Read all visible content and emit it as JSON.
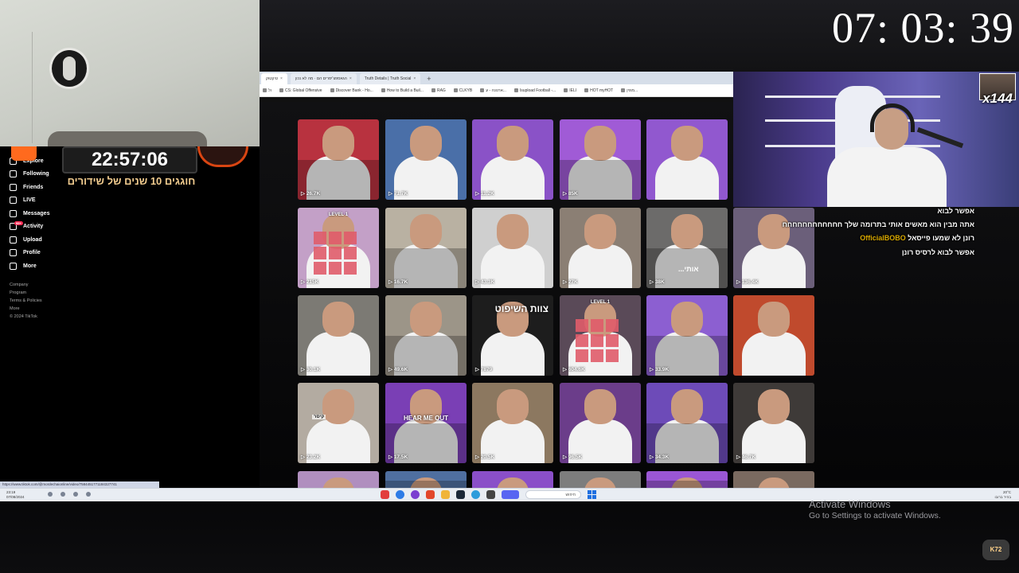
{
  "clock": "07: 03: 39",
  "overlay": {
    "timer": "22:57:06",
    "timer_sub": "חוגגים 10 שנים של שידורים",
    "multiplier": "x144"
  },
  "browser": {
    "tabs": [
      {
        "label": "טיקטוק",
        "active": true
      },
      {
        "label": "הגאספצ'יסרים הם · מה לא נכון",
        "active": false
      },
      {
        "label": "Truth Details | Truth Social",
        "active": false
      }
    ],
    "new_tab": "+",
    "bookmarks": [
      "ול",
      "CS: Global Offensive",
      "Discover Bank - Ho...",
      "How to Build a Buil...",
      "RAG",
      "CLKYB",
      "ארנונה - ע...",
      "Isupload Football -...",
      "IELI",
      "HOT myHOT",
      "מגזין..."
    ]
  },
  "sidebar": {
    "items": [
      {
        "label": "Explore",
        "icon": "compass-icon"
      },
      {
        "label": "Following",
        "icon": "following-icon"
      },
      {
        "label": "Friends",
        "icon": "friends-icon"
      },
      {
        "label": "LIVE",
        "icon": "live-icon"
      },
      {
        "label": "Messages",
        "icon": "messages-icon",
        "badge": ""
      },
      {
        "label": "Activity",
        "icon": "activity-icon",
        "badge": "99+"
      },
      {
        "label": "Upload",
        "icon": "upload-icon"
      },
      {
        "label": "Profile",
        "icon": "profile-icon"
      },
      {
        "label": "More",
        "icon": "more-icon"
      }
    ],
    "footer": [
      "Company",
      "Program",
      "Terms & Policies",
      "More",
      "© 2024 TikTok"
    ]
  },
  "videos": [
    {
      "views": "26.7K",
      "caption": "",
      "bg": "#b8323f"
    },
    {
      "views": "71.7K",
      "caption": "",
      "bg": "#4a6fa8"
    },
    {
      "views": "11.2K",
      "caption": "",
      "bg": "#8a52c7"
    },
    {
      "views": "85K",
      "caption": "",
      "bg": "#a05bd6"
    },
    {
      "views": "",
      "caption": "",
      "bg": "#9158cf"
    },
    {
      "views": "215K",
      "caption": "LEVEL 1",
      "bg": "#c3a0c7",
      "tiles": true
    },
    {
      "views": "16.7K",
      "caption": "",
      "bg": "#b9b1a2"
    },
    {
      "views": "43.3K",
      "caption": "",
      "bg": "#cfcfcf"
    },
    {
      "views": "27K",
      "caption": "",
      "bg": "#8b7f74"
    },
    {
      "views": "38K",
      "caption": "",
      "bg": "#6c6b6a",
      "otti": "אותי..."
    },
    {
      "views": "136.4K",
      "caption": "",
      "bg": "#6b5f7a"
    },
    {
      "views": "30.1K",
      "caption": "",
      "bg": "#7c7a74"
    },
    {
      "views": "49.6K",
      "caption": "",
      "bg": "#9c9588"
    },
    {
      "views": "7879",
      "caption": "",
      "bg": "#1d1d1d",
      "big": "צוות השיפוט"
    },
    {
      "views": "604.6K",
      "caption": "LEVEL 1",
      "bg": "#5a4a58",
      "tiles": true
    },
    {
      "views": "33.9K",
      "caption": "",
      "bg": "#8c5fd1"
    },
    {
      "views": "",
      "caption": "",
      "bg": "#c04a2d"
    },
    {
      "views": "23.2K",
      "caption": "",
      "bg": "#b3aba1",
      "kisur": "קיסר"
    },
    {
      "views": "17.5K",
      "caption": "",
      "bg": "#7a3fb5",
      "hme": "HEAR ME OUT"
    },
    {
      "views": "20.5K",
      "caption": "",
      "bg": "#8c7860"
    },
    {
      "views": "96.5K",
      "caption": "",
      "bg": "#6b3d8a"
    },
    {
      "views": "34.3K",
      "caption": "",
      "bg": "#6d4bb8"
    },
    {
      "views": "46.7K",
      "caption": "",
      "bg": "#3e3a38"
    },
    {
      "views": "",
      "caption": "",
      "bg": "#b08fbf"
    },
    {
      "views": "",
      "caption": "",
      "bg": "#4f6fa0"
    },
    {
      "views": "",
      "caption": "",
      "bg": "#8a4fc8"
    },
    {
      "views": "",
      "caption": "",
      "bg": "#7d7d7d"
    },
    {
      "views": "",
      "caption": "",
      "bg": "#9a56d4"
    },
    {
      "views": "",
      "caption": "",
      "bg": "#7a6a60"
    }
  ],
  "chat": [
    {
      "nick": "",
      "text": "אפשר לבוא"
    },
    {
      "nick": "",
      "text": "אתה מבין הוא מאשים אותי בתרומה שלך חחחחחחחחחחחח"
    },
    {
      "nick": "OfficialBOBO",
      "text": "רונן לא שמעו פייסאל"
    },
    {
      "nick": "",
      "text": "אפשר לבוא לרסיס רונן"
    }
  ],
  "taskbar": {
    "url_hint": "https://www.tiktok.com/@mordechaionline/video/7584451771184327741",
    "time": "23:19",
    "date": "07/08/2024",
    "search": "חיפוש",
    "weather": "20°C",
    "weather_sub": "בהיר ברובו"
  },
  "activate": {
    "title": "Activate Windows",
    "subtitle": "Go to Settings to activate Windows."
  },
  "corner_logo": "K72"
}
